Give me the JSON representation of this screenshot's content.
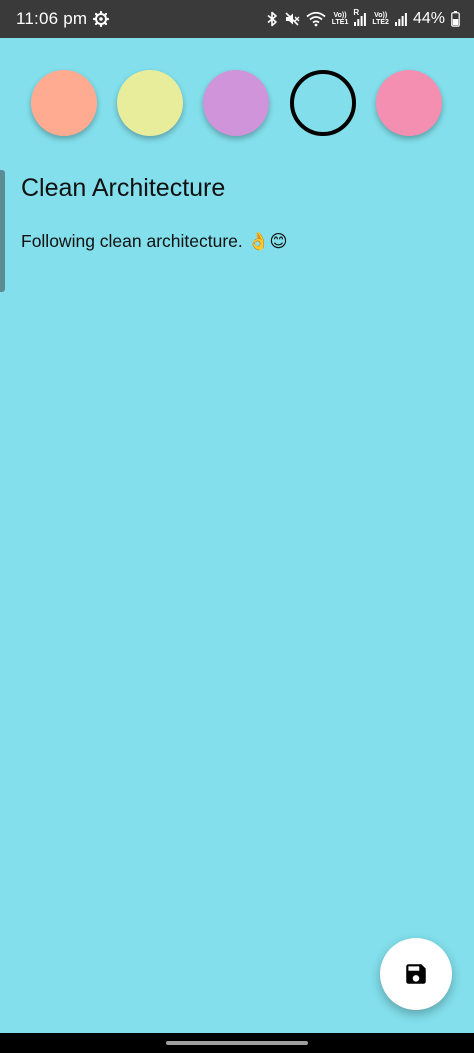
{
  "status_bar": {
    "time": "11:06 pm",
    "sim1_top": "Vo))",
    "sim1_bottom": "LTE1",
    "sim1_signal_label": "R",
    "sim2_top": "Vo))",
    "sim2_bottom": "LTE2",
    "battery": "44%",
    "icons": [
      "settings-gear-icon",
      "bluetooth-icon",
      "mute-icon",
      "wifi-icon",
      "signal-icon",
      "battery-icon"
    ]
  },
  "colors": {
    "background": "#82DFEB",
    "swatches": [
      "#FFAB91",
      "#E7ED9B",
      "#CF94DA",
      "#81DEEA",
      "#F48FB1"
    ],
    "selected_swatch_index": 3
  },
  "note": {
    "title": "Clean Architecture",
    "content": "Following clean architecture. 👌😊"
  },
  "fab": {
    "icon": "save-icon"
  }
}
